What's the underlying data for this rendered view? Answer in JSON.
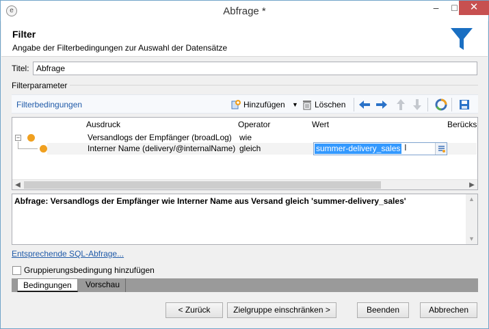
{
  "window": {
    "title": "Abfrage *",
    "minimize_label": "–",
    "maximize_label": "□",
    "close_label": "✕",
    "app_icon_label": "e"
  },
  "header": {
    "title": "Filter",
    "subtitle": "Angabe der Filterbedingungen zur Auswahl der Datensätze"
  },
  "form": {
    "title_label": "Titel:",
    "title_value": "Abfrage",
    "filter_params_label": "Filterparameter"
  },
  "toolbar": {
    "title": "Filterbedingungen",
    "add_label": "Hinzufügen",
    "delete_label": "Löschen"
  },
  "grid": {
    "columns": [
      "Ausdruck",
      "Operator",
      "Wert",
      "Berücks"
    ],
    "rows": [
      {
        "expression": "Versandlogs der Empfänger (broadLog)",
        "operator": "wie",
        "value": ""
      },
      {
        "expression": "Interner Name (delivery/@internalName)",
        "operator": "gleich",
        "value": "summer-delivery_sales"
      }
    ]
  },
  "summary": {
    "text": "Abfrage: Versandlogs der Empfänger wie Interner Name aus Versand gleich 'summer-delivery_sales'"
  },
  "sql_link": "Entsprechende SQL-Abfrage...",
  "group_checkbox": {
    "label": "Gruppierungsbedingung hinzufügen",
    "checked": false
  },
  "tabs": [
    {
      "label": "Bedingungen",
      "active": true
    },
    {
      "label": "Vorschau",
      "active": false
    }
  ],
  "buttons": {
    "back": "< Zurück",
    "next": "Zielgruppe einschränken >",
    "finish": "Beenden",
    "cancel": "Abbrechen"
  },
  "colors": {
    "accent_blue": "#1f5aa8",
    "node_orange": "#f0a020",
    "selection_blue": "#3399ff",
    "close_red": "#c75050"
  }
}
